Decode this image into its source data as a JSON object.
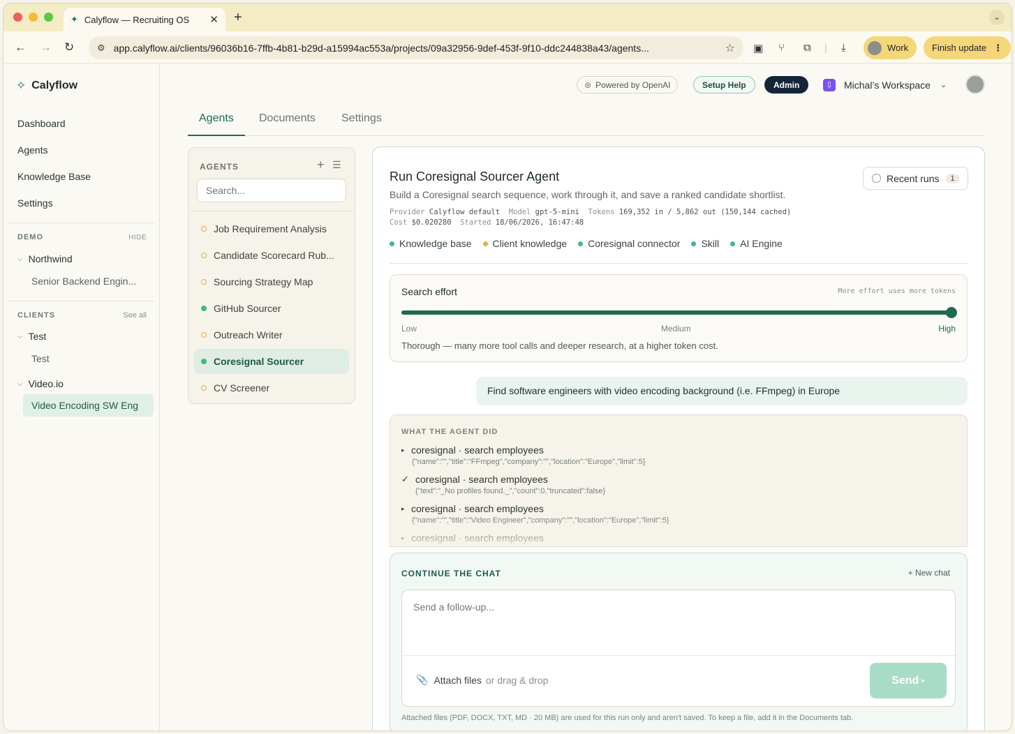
{
  "browser": {
    "tab_title": "Calyflow — Recruiting OS",
    "url": "app.calyflow.ai/clients/96036b16-7ffb-4b81-b29d-a15994ac553a/projects/09a32956-9def-453f-9f10-ddc244838a43/agents...",
    "profile_label": "Work",
    "update_label": "Finish update"
  },
  "sidebar": {
    "brand": "Calyflow",
    "nav": [
      "Dashboard",
      "Agents",
      "Knowledge Base",
      "Settings"
    ],
    "demo_label": "DEMO",
    "demo_hide": "HIDE",
    "demo_client": "Northwind",
    "demo_project": "Senior Backend Engin...",
    "clients_label": "CLIENTS",
    "clients_see_all": "See all",
    "client_test": "Test",
    "client_test_project": "Test",
    "client_video": "Video.io",
    "client_video_project": "Video Encoding SW Eng"
  },
  "header": {
    "powered": "Powered by OpenAI",
    "setup_help": "Setup Help",
    "admin": "Admin",
    "workspace": "Michal’s Workspace"
  },
  "tabs": [
    "Agents",
    "Documents",
    "Settings"
  ],
  "agents_panel": {
    "title": "AGENTS",
    "search_placeholder": "Search...",
    "items": [
      {
        "label": "Job Requirement Analysis",
        "status": "pending"
      },
      {
        "label": "Candidate Scorecard Rub...",
        "status": "pending"
      },
      {
        "label": "Sourcing Strategy Map",
        "status": "pending"
      },
      {
        "label": "GitHub Sourcer",
        "status": "ready"
      },
      {
        "label": "Outreach Writer",
        "status": "pending"
      },
      {
        "label": "Coresignal Sourcer",
        "status": "ready"
      },
      {
        "label": "CV Screener",
        "status": "pending"
      }
    ]
  },
  "run": {
    "title": "Run Coresignal Sourcer Agent",
    "subtitle": "Build a Coresignal search sequence, work through it, and save a ranked candidate shortlist.",
    "recent_runs": "Recent runs",
    "recent_count": "1",
    "meta": {
      "provider_k": "Provider",
      "provider_v": "Calyflow default",
      "model_k": "Model",
      "model_v": "gpt-5-mini",
      "tokens_k": "Tokens",
      "tokens_v": "169,352 in / 5,862 out (150,144 cached)",
      "cost_k": "Cost",
      "cost_v": "$0.020280",
      "started_k": "Started",
      "started_v": "18/06/2026, 16:47:48"
    },
    "tags": [
      {
        "label": "Knowledge base",
        "color": "#3dba7e"
      },
      {
        "label": "Client knowledge",
        "color": "#e0b23a"
      },
      {
        "label": "Coresignal connector",
        "color": "#3dba7e"
      },
      {
        "label": "Skill",
        "color": "#3dba7e"
      },
      {
        "label": "AI Engine",
        "color": "#3dba7e"
      }
    ],
    "effort": {
      "title": "Search effort",
      "hint": "More effort uses more tokens",
      "low": "Low",
      "medium": "Medium",
      "high": "High",
      "level": 1.0,
      "description": "Thorough — many more tool calls and deeper research, at a higher token cost."
    },
    "user_message": "Find software engineers with video encoding background (i.e. FFmpeg) in Europe",
    "did_title": "WHAT THE AGENT DID",
    "did_items": [
      {
        "tool": "coresignal · search employees",
        "args": "{\"name\":\"\",\"title\":\"FFmpeg\",\"company\":\"\",\"location\":\"Europe\",\"limit\":5}",
        "done": false
      },
      {
        "tool": "coresignal · search employees",
        "args": "{\"text\":\"_No profiles found._\",\"count\":0,\"truncated\":false}",
        "done": true
      },
      {
        "tool": "coresignal · search employees",
        "args": "{\"name\":\"\",\"title\":\"Video Engineer\",\"company\":\"\",\"location\":\"Europe\",\"limit\":5}",
        "done": false
      },
      {
        "tool": "coresignal · search employees",
        "args": "",
        "done": false
      }
    ],
    "chat": {
      "title": "CONTINUE THE CHAT",
      "new_chat": "+ New chat",
      "placeholder": "Send a follow-up...",
      "attach": "Attach files",
      "drag": "or drag & drop",
      "send": "Send",
      "footer": "Attached files (PDF, DOCX, TXT, MD · 20 MB) are used for this run only and aren't saved. To keep a file, add it in the Documents tab."
    }
  }
}
